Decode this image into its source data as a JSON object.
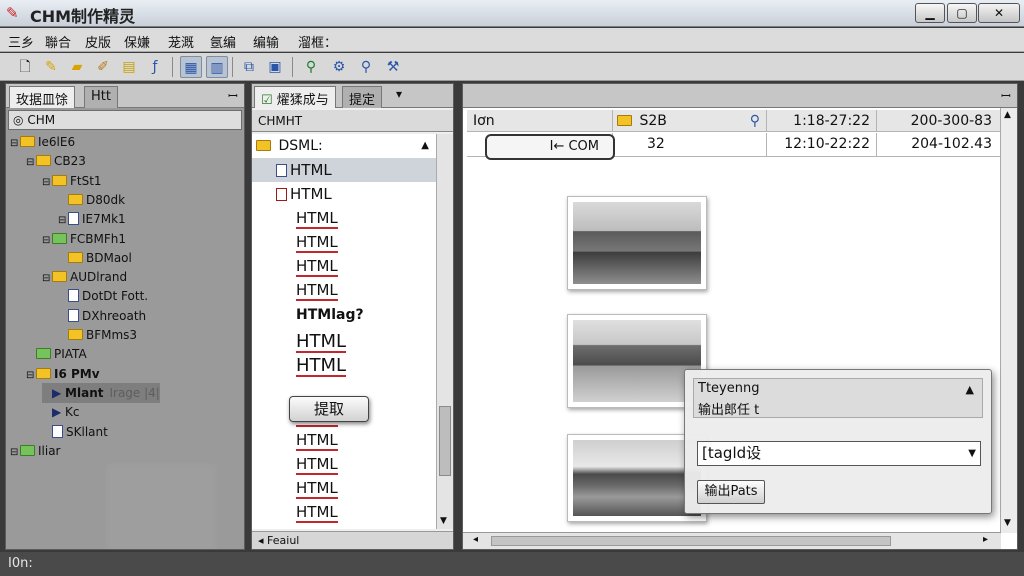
{
  "window": {
    "title": "CHM制作精灵",
    "minimize": "▁",
    "maximize": "▢",
    "close": "✕"
  },
  "menu": [
    "三乡",
    "聯合",
    "皮版",
    "保嫌",
    "茏溉",
    "氬编",
    "编输",
    "溜框："
  ],
  "toolbar": {
    "icons": [
      "new-file-icon",
      "open-file-icon",
      "open-folder-icon",
      "edit-icon",
      "document-icon",
      "function-icon",
      "layout-icon",
      "page-icon",
      "copy-icon",
      "save-icon",
      "search-icon",
      "settings-icon",
      "zoom-icon",
      "tools-icon"
    ]
  },
  "left_panel": {
    "tab_active": "玫据皿馀",
    "tab_inactive": "Htt",
    "pin": "ꟷ",
    "address": "CHM",
    "tree": [
      {
        "indent": 0,
        "exp": "⊟",
        "icon": "folder",
        "label": "Ie6lE6"
      },
      {
        "indent": 1,
        "exp": "⊟",
        "icon": "folder",
        "label": "CB23"
      },
      {
        "indent": 2,
        "exp": "⊟",
        "icon": "folder",
        "label": "FtSt1"
      },
      {
        "indent": 3,
        "exp": "",
        "icon": "folder",
        "label": "D80dk"
      },
      {
        "indent": 3,
        "exp": "⊟",
        "icon": "doc",
        "label": "IE7Mk1"
      },
      {
        "indent": 2,
        "exp": "⊟",
        "icon": "folder-green",
        "label": "FCBMFh1"
      },
      {
        "indent": 3,
        "exp": "",
        "icon": "folder",
        "label": "BDMaol"
      },
      {
        "indent": 2,
        "exp": "⊟",
        "icon": "folder",
        "label": "AUDlrand"
      },
      {
        "indent": 3,
        "exp": "",
        "icon": "doc",
        "label": "DotDt Fott."
      },
      {
        "indent": 3,
        "exp": "",
        "icon": "doc",
        "label": "DXhreoath"
      },
      {
        "indent": 3,
        "exp": "",
        "icon": "folder",
        "label": "BFMms3"
      },
      {
        "indent": 1,
        "exp": "",
        "icon": "folder-green",
        "label": "PIATA"
      },
      {
        "indent": 1,
        "exp": "⊟",
        "icon": "folder",
        "label": "I6 PMv"
      },
      {
        "indent": 2,
        "exp": "",
        "icon": "arrow",
        "label": "Mlant",
        "extra": "Irage |4|"
      },
      {
        "indent": 2,
        "exp": "",
        "icon": "arrow",
        "label": "Kc"
      },
      {
        "indent": 2,
        "exp": "",
        "icon": "doc",
        "label": "SKllant"
      },
      {
        "indent": 0,
        "exp": "⊟",
        "icon": "folder-green",
        "label": "Iliar"
      }
    ]
  },
  "mid_panel": {
    "tab_active": "燿猱成与",
    "tab_inactive": "提定",
    "tab_more": "▾",
    "header": "CHMHT",
    "root_label": "DSML:",
    "rows": [
      "HTML",
      "HTML",
      "HTML",
      "HTML",
      "HTML",
      "HTML",
      "HTMlag?",
      "HTML",
      "HTML",
      "HTML",
      "HTML",
      "HTML",
      "HTML",
      "HTML"
    ],
    "popup": "提取",
    "footer": "Feaiul"
  },
  "right_panel": {
    "tabs_pin": "ꟷ",
    "rows": [
      {
        "c1": "Iơn",
        "c2": "S2B",
        "c3": "1:18-27:22",
        "c4": "200-300-83"
      },
      {
        "c1": "I← COM",
        "c2": "32",
        "c3": "12:10-22:22",
        "c4": "204-102.43"
      }
    ],
    "photos": [
      "building-photo",
      "path-photo",
      "road-photo"
    ]
  },
  "dialog": {
    "line1": "Tteyenng",
    "line2": "输出郎任 t",
    "select_value": "[tagld设",
    "button": "输出Pats"
  },
  "status": "I0n:"
}
